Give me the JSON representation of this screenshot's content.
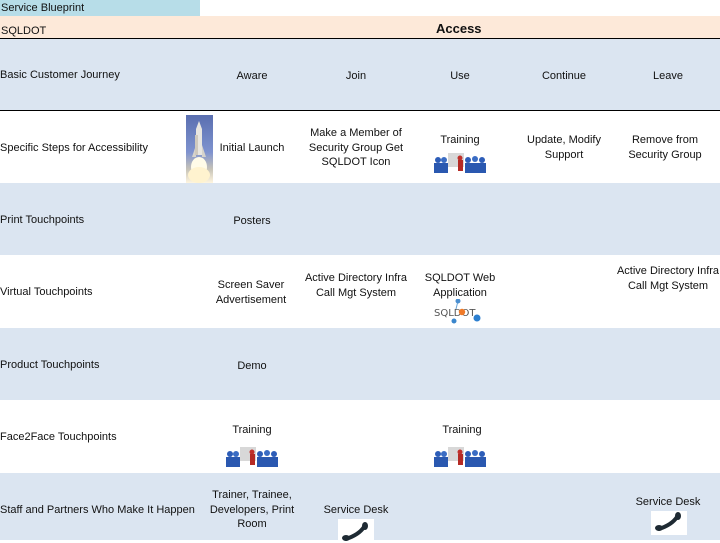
{
  "header": {
    "title": "Service Blueprint",
    "organization": "SQLDOT",
    "phase": "Access"
  },
  "colors": {
    "title_band": "#b7dde8",
    "phase_band": "#fde9d9",
    "row_blue": "#dbe5f1",
    "row_white": "#ffffff"
  },
  "journey": {
    "label": "Basic Customer Journey",
    "stages": [
      "Aware",
      "Join",
      "Use",
      "Continue",
      "Leave"
    ]
  },
  "rows": {
    "steps": {
      "label": "Specific Steps for Accessibility",
      "aware": "Initial Launch",
      "aware_image": "space-shuttle-launch-image",
      "join": "Make a Member of Security Group Get SQLDOT Icon",
      "use": "Training",
      "use_image": "training-presentation-image",
      "continue": "Update, Modify Support",
      "leave": "Remove from Security Group"
    },
    "print": {
      "label": "Print Touchpoints",
      "aware": "Posters"
    },
    "virtual": {
      "label": "Virtual Touchpoints",
      "aware": "Screen Saver Advertisement",
      "join": "Active Directory Infra Call Mgt System",
      "use": "SQLDOT  Web Application",
      "use_logo_text": "SQLDOT",
      "leave": "Active Directory Infra Call Mgt System"
    },
    "product": {
      "label": "Product Touchpoints",
      "aware": "Demo"
    },
    "face2face": {
      "label": "Face2Face Touchpoints",
      "aware": "Training",
      "aware_image": "training-presentation-image",
      "use": "Training",
      "use_image": "training-presentation-image"
    },
    "staff": {
      "label": "Staff and Partners Who Make It Happen",
      "aware": "Trainer, Trainee, Developers, Print Room",
      "join": "Service Desk",
      "join_icon": "telephone-icon",
      "leave": "Service Desk",
      "leave_icon": "telephone-icon"
    }
  }
}
